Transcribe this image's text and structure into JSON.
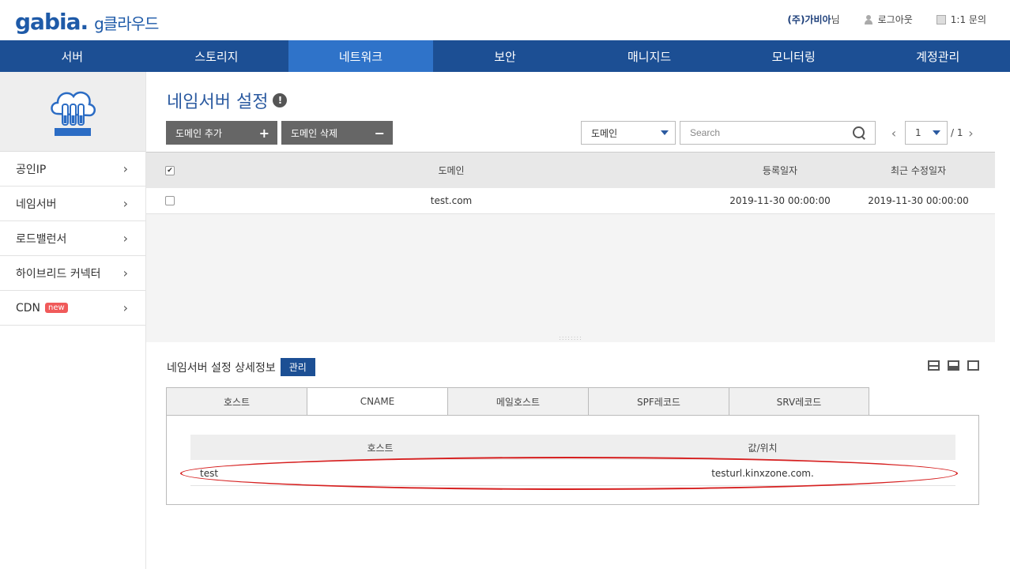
{
  "brand": {
    "logo": "gabia.",
    "product": "g클라우드"
  },
  "header": {
    "company": "(주)가비아",
    "company_suffix": "님",
    "logout": "로그아웃",
    "inquiry": "1:1 문의"
  },
  "topnav": [
    {
      "label": "서버",
      "active": false
    },
    {
      "label": "스토리지",
      "active": false
    },
    {
      "label": "네트워크",
      "active": true
    },
    {
      "label": "보안",
      "active": false
    },
    {
      "label": "매니지드",
      "active": false
    },
    {
      "label": "모니터링",
      "active": false
    },
    {
      "label": "계정관리",
      "active": false
    }
  ],
  "sidebar": {
    "icon": "cloud-server-icon",
    "items": [
      {
        "label": "공인IP"
      },
      {
        "label": "네임서버"
      },
      {
        "label": "로드밸런서"
      },
      {
        "label": "하이브리드 커넥터"
      },
      {
        "label": "CDN",
        "badge": "new"
      }
    ]
  },
  "page": {
    "title": "네임서버 설정",
    "add_domain": "도메인 추가",
    "add_symbol": "+",
    "delete_domain": "도메인 삭제",
    "delete_symbol": "−",
    "filter_select": "도메인",
    "search_placeholder": "Search",
    "page_current": "1",
    "page_total": "/ 1"
  },
  "table": {
    "columns": {
      "domain": "도메인",
      "registered": "등록일자",
      "modified": "최근 수정일자"
    },
    "rows": [
      {
        "checked": false,
        "domain": "test.com",
        "registered": "2019-11-30 00:00:00",
        "modified": "2019-11-30 00:00:00"
      }
    ]
  },
  "detail": {
    "title": "네임서버 설정 상세정보",
    "manage": "관리",
    "tabs": [
      {
        "label": "호스트",
        "active": false
      },
      {
        "label": "CNAME",
        "active": true
      },
      {
        "label": "메일호스트",
        "active": false
      },
      {
        "label": "SPF레코드",
        "active": false
      },
      {
        "label": "SRV레코드",
        "active": false
      }
    ],
    "columns": {
      "host": "호스트",
      "value": "값/위치"
    },
    "rows": [
      {
        "host": "test",
        "value": "testurl.kinxzone.com."
      }
    ]
  },
  "colors": {
    "nav_bg": "#1c4f94",
    "nav_active": "#2f73c9",
    "highlight": "#d62020"
  }
}
